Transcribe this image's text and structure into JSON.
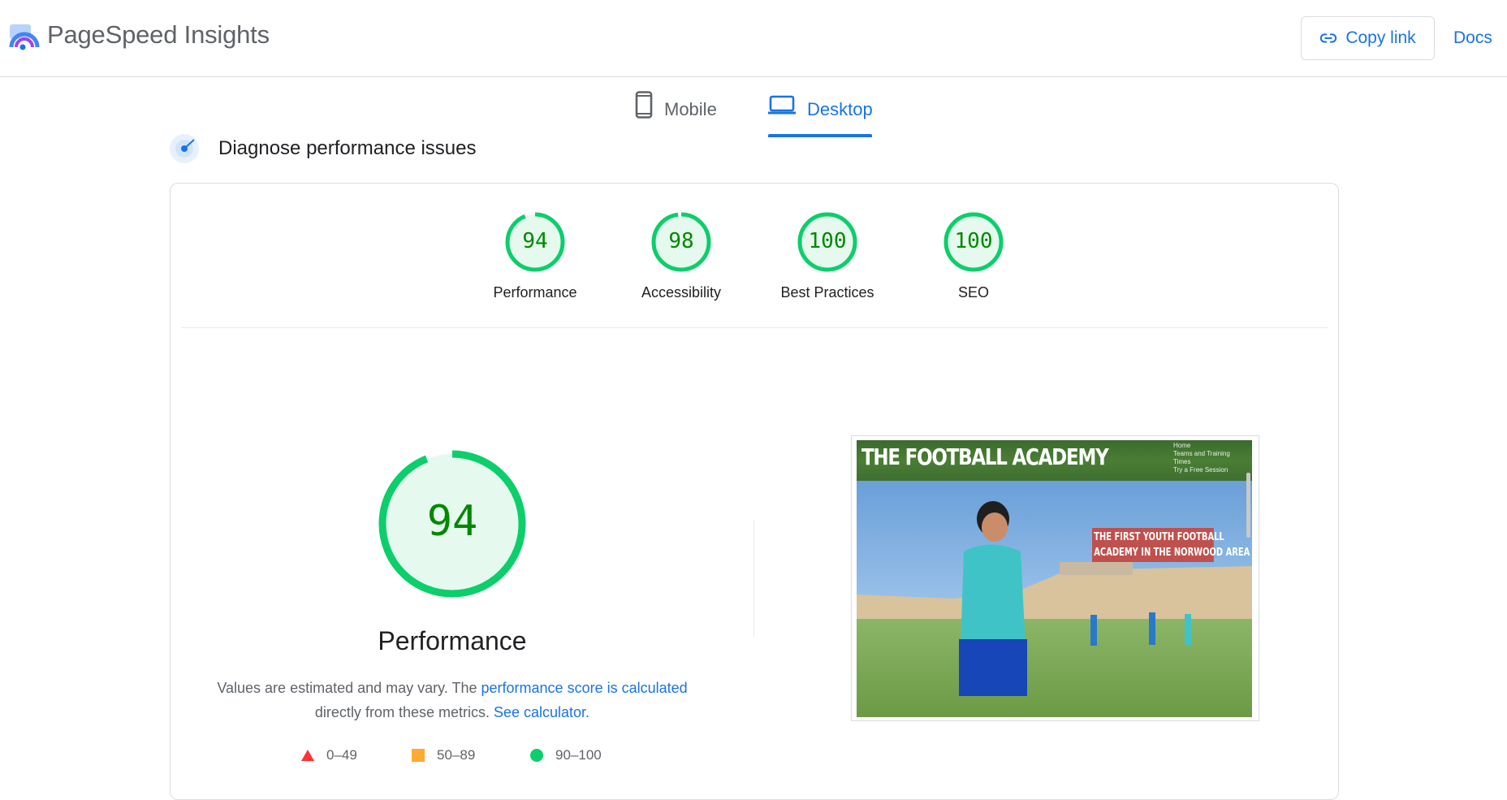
{
  "header": {
    "brand": "PageSpeed Insights",
    "copy_link_label": "Copy link",
    "docs_label": "Docs"
  },
  "device_tabs": {
    "mobile_label": "Mobile",
    "desktop_label": "Desktop",
    "selected": "Desktop"
  },
  "diagnose": {
    "title": "Diagnose performance issues"
  },
  "scores": [
    {
      "label": "Performance",
      "value": "94",
      "fraction": 0.94
    },
    {
      "label": "Accessibility",
      "value": "98",
      "fraction": 0.98
    },
    {
      "label": "Best Practices",
      "value": "100",
      "fraction": 1.0
    },
    {
      "label": "SEO",
      "value": "100",
      "fraction": 1.0
    }
  ],
  "performance": {
    "score": "94",
    "fraction": 0.94,
    "title": "Performance",
    "desc_prefix": "Values are estimated and may vary. The ",
    "link_score": "performance score is calculated",
    "desc_mid": " directly from these metrics. ",
    "link_calculator": "See calculator."
  },
  "legend": [
    {
      "range": "0–49",
      "shape": "triangle",
      "color": "#ff3333"
    },
    {
      "range": "50–89",
      "shape": "square",
      "color": "#ffaa33"
    },
    {
      "range": "90–100",
      "shape": "circle",
      "color": "#0cce6b"
    }
  ],
  "screenshot": {
    "site_title": "THE FOOTBALL ACADEMY",
    "nav_items": [
      "Home",
      "Teams and Training",
      "Times",
      "Try a Free Session"
    ],
    "banner_line1": "THE FIRST YOUTH FOOTBALL",
    "banner_line2": "ACADEMY IN THE NORWOOD AREA"
  },
  "colors": {
    "accent": "#1a73e8",
    "pass_green": "#0cce6b",
    "pass_text": "#008800",
    "pass_fill": "#e6f9ee"
  }
}
